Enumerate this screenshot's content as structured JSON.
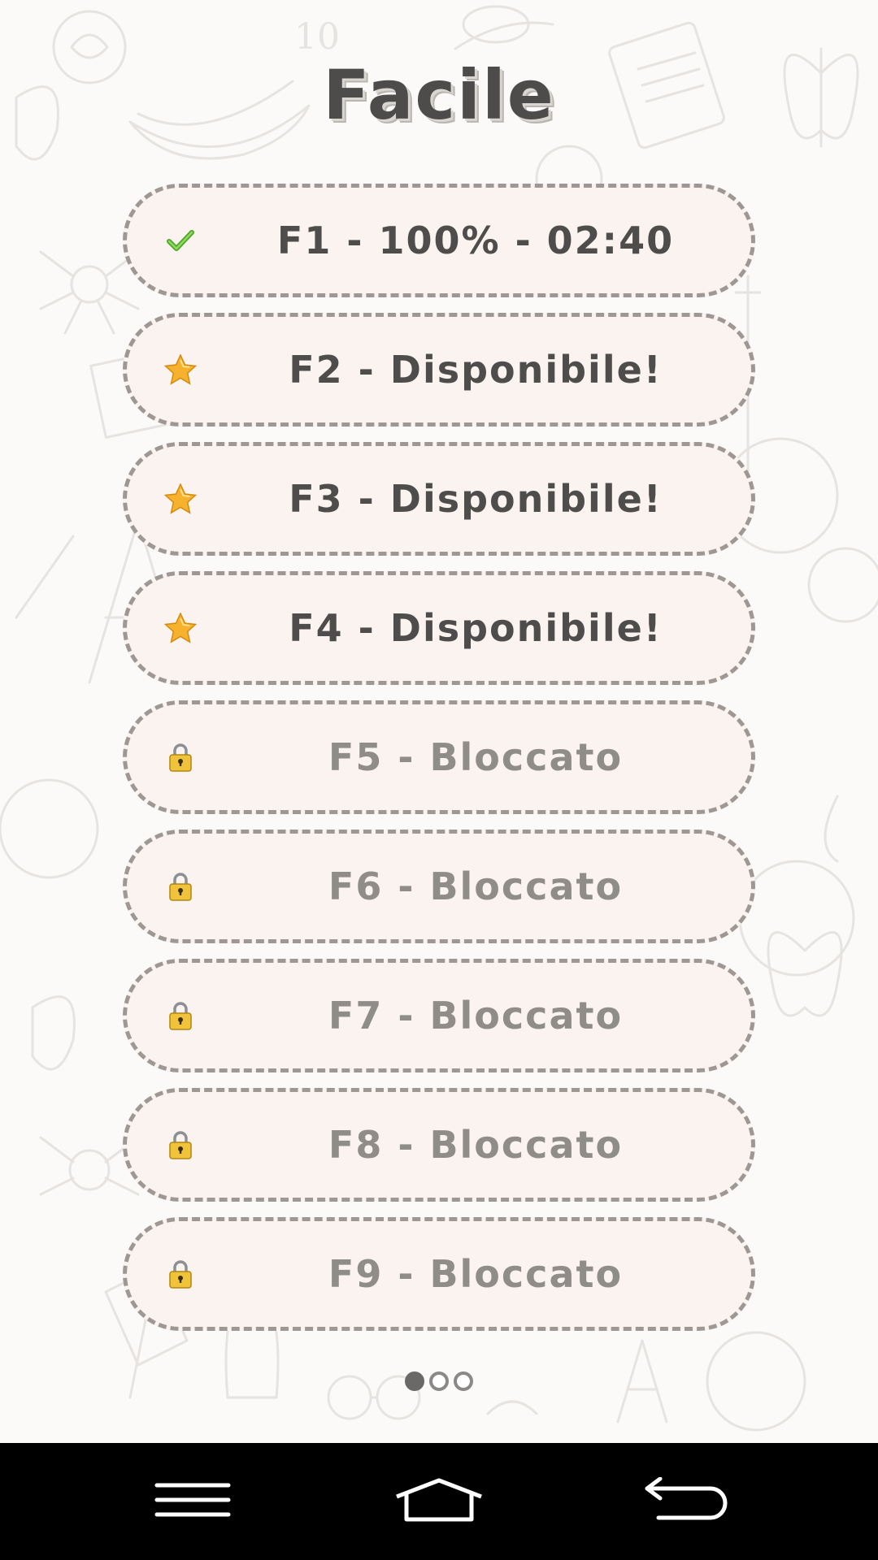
{
  "screen": {
    "title": "Facile"
  },
  "levels": [
    {
      "label": "F1 - 100% - 02:40",
      "status": "completed",
      "icon": "checkmark-icon"
    },
    {
      "label": "F2 - Disponibile!",
      "status": "available",
      "icon": "star-icon"
    },
    {
      "label": "F3 - Disponibile!",
      "status": "available",
      "icon": "star-icon"
    },
    {
      "label": "F4 - Disponibile!",
      "status": "available",
      "icon": "star-icon"
    },
    {
      "label": "F5 - Bloccato",
      "status": "locked",
      "icon": "padlock-icon"
    },
    {
      "label": "F6 - Bloccato",
      "status": "locked",
      "icon": "padlock-icon"
    },
    {
      "label": "F7 - Bloccato",
      "status": "locked",
      "icon": "padlock-icon"
    },
    {
      "label": "F8 - Bloccato",
      "status": "locked",
      "icon": "padlock-icon"
    },
    {
      "label": "F9 - Bloccato",
      "status": "locked",
      "icon": "padlock-icon"
    }
  ],
  "pager": {
    "pages": 3,
    "current": 1
  },
  "navbar": {
    "items": [
      "menu-icon",
      "home-icon",
      "back-icon"
    ]
  },
  "colors": {
    "background": "#fbfaf8",
    "card_fill": "#faf3ef",
    "card_border": "#9e9793",
    "text_dark": "#4f4d4c",
    "text_locked": "#8f8c8a",
    "star": "#f5a623",
    "check": "#5cb531",
    "lock": "#e8b830",
    "navbar": "#000000"
  }
}
